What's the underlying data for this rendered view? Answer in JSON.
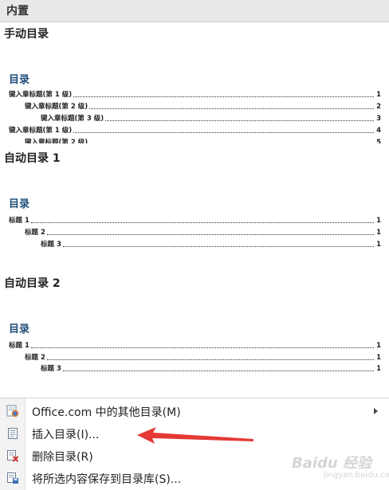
{
  "header": {
    "title": "内置"
  },
  "sections": {
    "manual": {
      "title": "手动目录",
      "toc_heading": "目录",
      "rows": [
        {
          "text": "键入章标题(第 1 级)",
          "num": "1"
        },
        {
          "text": "键入章标题(第 2 级)",
          "num": "2"
        },
        {
          "text": "键入章标题(第 3 级)",
          "num": "3"
        },
        {
          "text": "键入章标题(第 1 级)",
          "num": "4"
        },
        {
          "text": "键入章标题(第 2 级)",
          "num": "5"
        }
      ]
    },
    "auto1": {
      "title": "自动目录 1",
      "toc_heading": "目录",
      "rows": [
        {
          "text": "标题 1",
          "num": "1"
        },
        {
          "text": "标题 2",
          "num": "1"
        },
        {
          "text": "标题 3",
          "num": "1"
        }
      ]
    },
    "auto2": {
      "title": "自动目录 2",
      "toc_heading": "目录",
      "rows": [
        {
          "text": "标题 1",
          "num": "1"
        },
        {
          "text": "标题 2",
          "num": "1"
        },
        {
          "text": "标题 3",
          "num": "1"
        }
      ]
    }
  },
  "menu": {
    "items": [
      {
        "label": "Office.com 中的其他目录(M)",
        "icon": "office-globe-icon",
        "has_submenu": true
      },
      {
        "label": "插入目录(I)...",
        "icon": "document-icon"
      },
      {
        "label": "删除目录(R)",
        "icon": "delete-document-icon"
      },
      {
        "label": "将所选内容保存到目录库(S)...",
        "icon": "save-to-gallery-icon"
      }
    ]
  },
  "annotation": {
    "arrow_color": "#e53935"
  },
  "watermark": {
    "text": "Baidu 经验",
    "sub": "jingyan.baidu.com"
  }
}
